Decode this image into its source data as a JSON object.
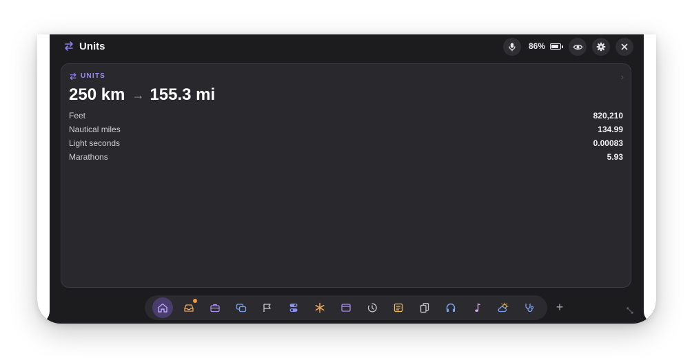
{
  "header": {
    "title": "Units",
    "battery": "86%",
    "battery_level": 0.86
  },
  "card": {
    "label": "UNITS",
    "from": "250 km",
    "to": "155.3 mi",
    "rows": [
      {
        "label": "Feet",
        "value": "820,210"
      },
      {
        "label": "Nautical miles",
        "value": "134.99"
      },
      {
        "label": "Light seconds",
        "value": "0.00083"
      },
      {
        "label": "Marathons",
        "value": "5.93"
      }
    ]
  },
  "dock": {
    "items": [
      "home-icon",
      "inbox-icon",
      "briefcase-icon",
      "chat-icon",
      "flag-icon",
      "toggles-icon",
      "asterisk-icon",
      "window-icon",
      "timer-icon",
      "notes-icon",
      "copy-icon",
      "headphones-icon",
      "music-note-icon",
      "weather-icon",
      "stethoscope-icon"
    ],
    "add_label": "+"
  },
  "colors": {
    "accent": "#9a8cf0",
    "badge": "#f59a3c",
    "background": "#1c1c1f",
    "card": "#28282d"
  }
}
